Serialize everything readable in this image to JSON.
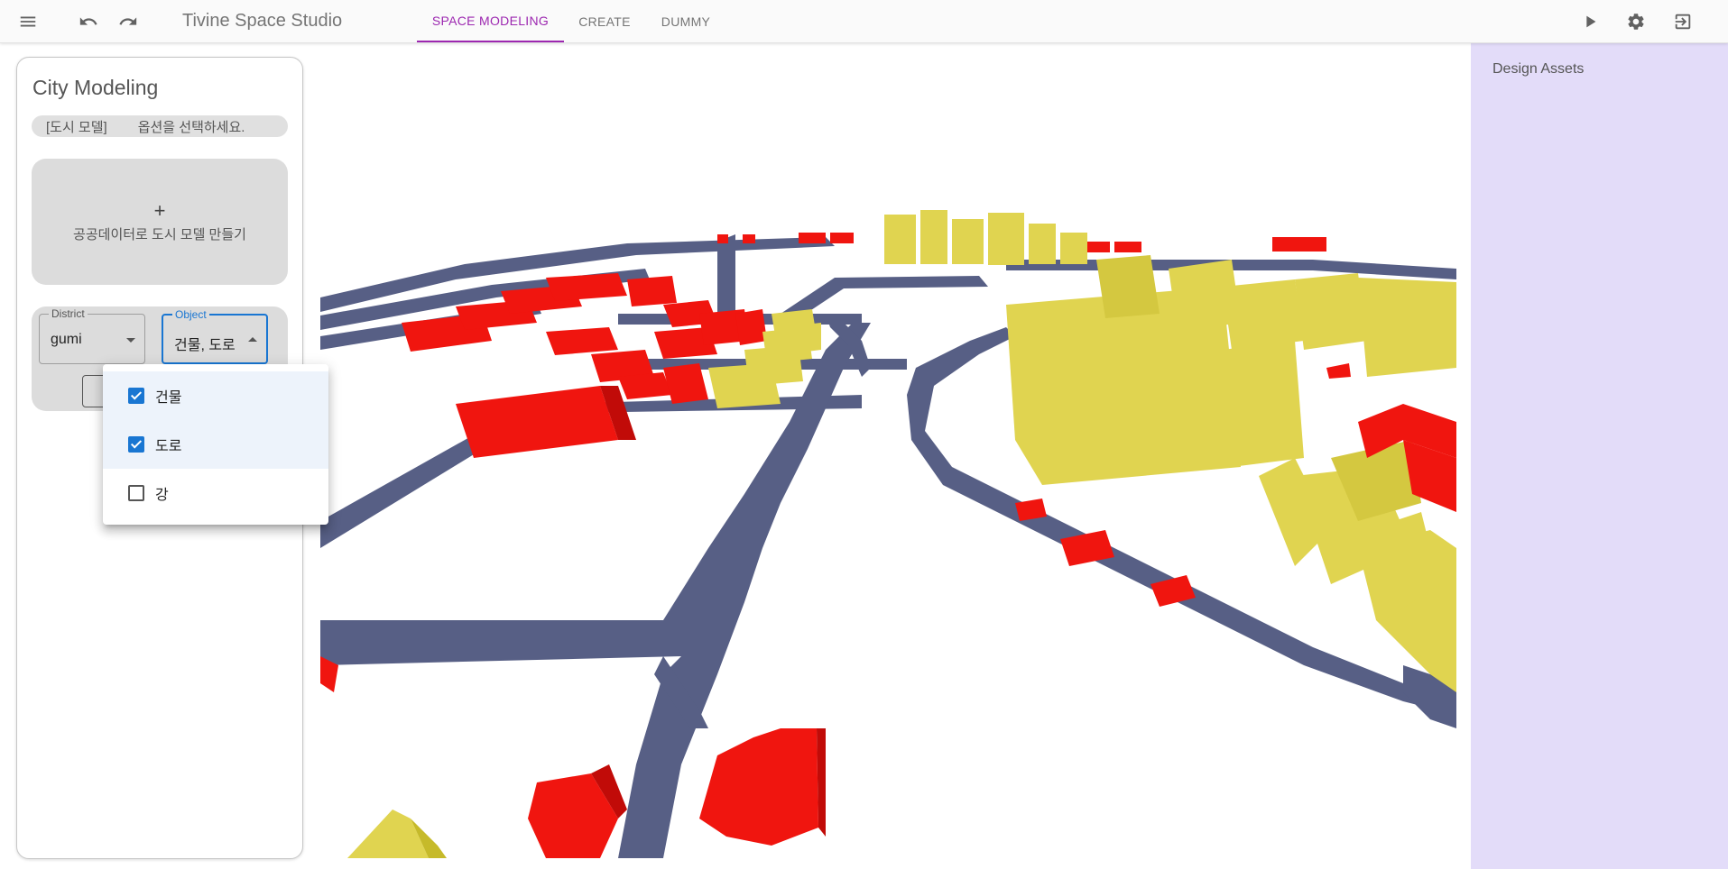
{
  "header": {
    "menu_icon": "hamburger-menu-icon",
    "undo_icon": "undo-icon",
    "redo_icon": "redo-icon",
    "app_title": "Tivine Space Studio",
    "tabs": [
      {
        "label": "SPACE MODELING",
        "active": true
      },
      {
        "label": "CREATE",
        "active": false
      },
      {
        "label": "DUMMY",
        "active": false
      }
    ],
    "actions": [
      "play-icon",
      "gear-icon",
      "logout-icon"
    ],
    "accent_color": "#9c27b0"
  },
  "left_panel": {
    "title": "City Modeling",
    "chip": {
      "tag": "[도시 모델]",
      "hint": "옵션을 선택하세요."
    },
    "create_card": {
      "plus": "+",
      "label": "공공데이터로 도시 모델 만들기"
    },
    "district": {
      "label": "District",
      "value": "gumi"
    },
    "object": {
      "label": "Object",
      "value": "건물, 도로"
    }
  },
  "object_menu": {
    "items": [
      {
        "label": "건물",
        "checked": true
      },
      {
        "label": "도로",
        "checked": true
      },
      {
        "label": "강",
        "checked": false
      }
    ]
  },
  "viewport": {
    "scene": "3D city model",
    "colors": {
      "road": "#575f85",
      "building_primary": "#e0d450",
      "building_secondary": "#f0150f"
    }
  },
  "right_panel": {
    "title": "Design Assets",
    "background": "#e3dcf9"
  }
}
